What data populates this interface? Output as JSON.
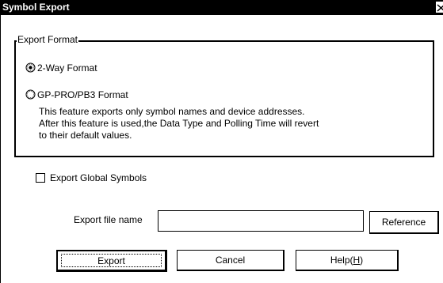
{
  "window": {
    "title": "Symbol Export"
  },
  "export_format": {
    "legend": "Export Format",
    "options": [
      {
        "label": "2-Way Format",
        "selected": true
      },
      {
        "label": "GP-PRO/PB3 Format",
        "selected": false
      }
    ],
    "description_lines": [
      "This feature exports only symbol names and device addresses.",
      "After this feature is used,the Data Type and Polling Time will revert",
      "to their default values."
    ]
  },
  "global_symbols": {
    "label": "Export Global Symbols",
    "checked": false
  },
  "file": {
    "label": "Export file name",
    "value": "",
    "reference_label": "Reference"
  },
  "buttons": {
    "export_label": "Export",
    "cancel_label": "Cancel",
    "help_label": "Help(",
    "help_mnemonic": "H",
    "help_suffix": ")"
  },
  "icons": {
    "close": "close-icon",
    "radio_selected": "radio-selected-icon",
    "radio_unselected": "radio-unselected-icon"
  }
}
